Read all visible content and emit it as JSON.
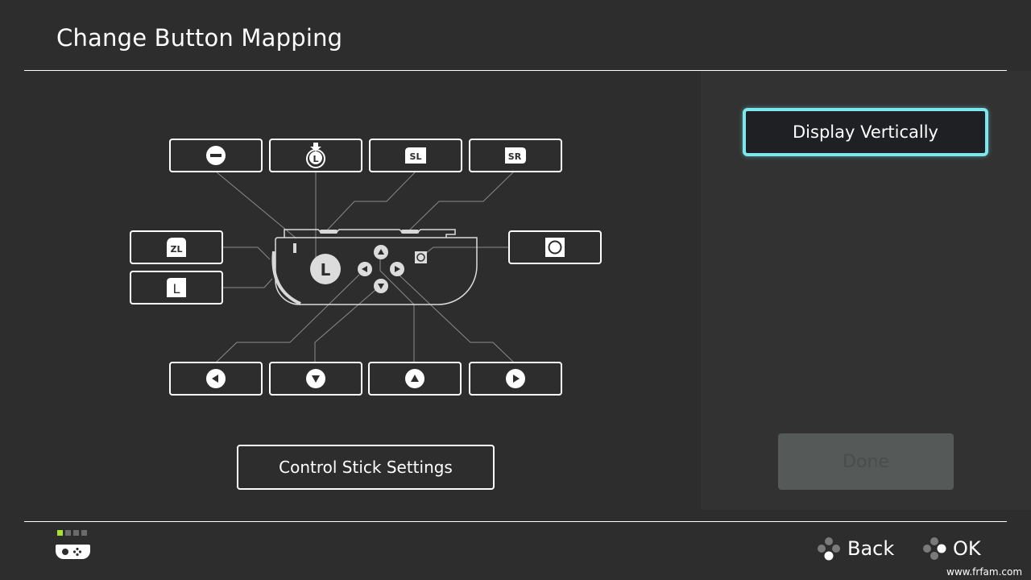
{
  "header": {
    "title": "Change Button Mapping"
  },
  "mapping": {
    "top_row": [
      {
        "id": "minus",
        "icon": "minus-button-icon",
        "label": "−"
      },
      {
        "id": "capture",
        "icon": "stick-press-L-icon",
        "label": "L"
      },
      {
        "id": "sl",
        "icon": "sl-button-icon",
        "label": "SL"
      },
      {
        "id": "sr",
        "icon": "sr-button-icon",
        "label": "SR"
      }
    ],
    "left_col": [
      {
        "id": "zl",
        "icon": "zl-button-icon",
        "label": "ZL"
      },
      {
        "id": "l",
        "icon": "l-button-icon",
        "label": "L"
      }
    ],
    "right_col": [
      {
        "id": "capture-btn",
        "icon": "capture-button-icon",
        "label": "○"
      }
    ],
    "bottom_row": [
      {
        "id": "left",
        "icon": "dpad-left-icon",
        "label": "◀"
      },
      {
        "id": "down",
        "icon": "dpad-down-icon",
        "label": "▼"
      },
      {
        "id": "up",
        "icon": "dpad-up-icon",
        "label": "▲"
      },
      {
        "id": "right",
        "icon": "dpad-right-icon",
        "label": "▶"
      }
    ],
    "controller": {
      "stick_label": "L",
      "type": "Joy-Con (L) horizontal"
    }
  },
  "buttons": {
    "control_stick_settings": "Control Stick Settings",
    "display_vertically": "Display Vertically",
    "done": "Done"
  },
  "footer": {
    "player_indicator": {
      "active": 1,
      "total": 4,
      "active_color": "#a6e22e"
    },
    "back_label": "Back",
    "ok_label": "OK",
    "watermark": "www.frfam.com"
  },
  "colors": {
    "background": "#2d2d2d",
    "panel": "#323232",
    "focus_outline": "#7ce8ee",
    "done_bg": "#555957"
  }
}
